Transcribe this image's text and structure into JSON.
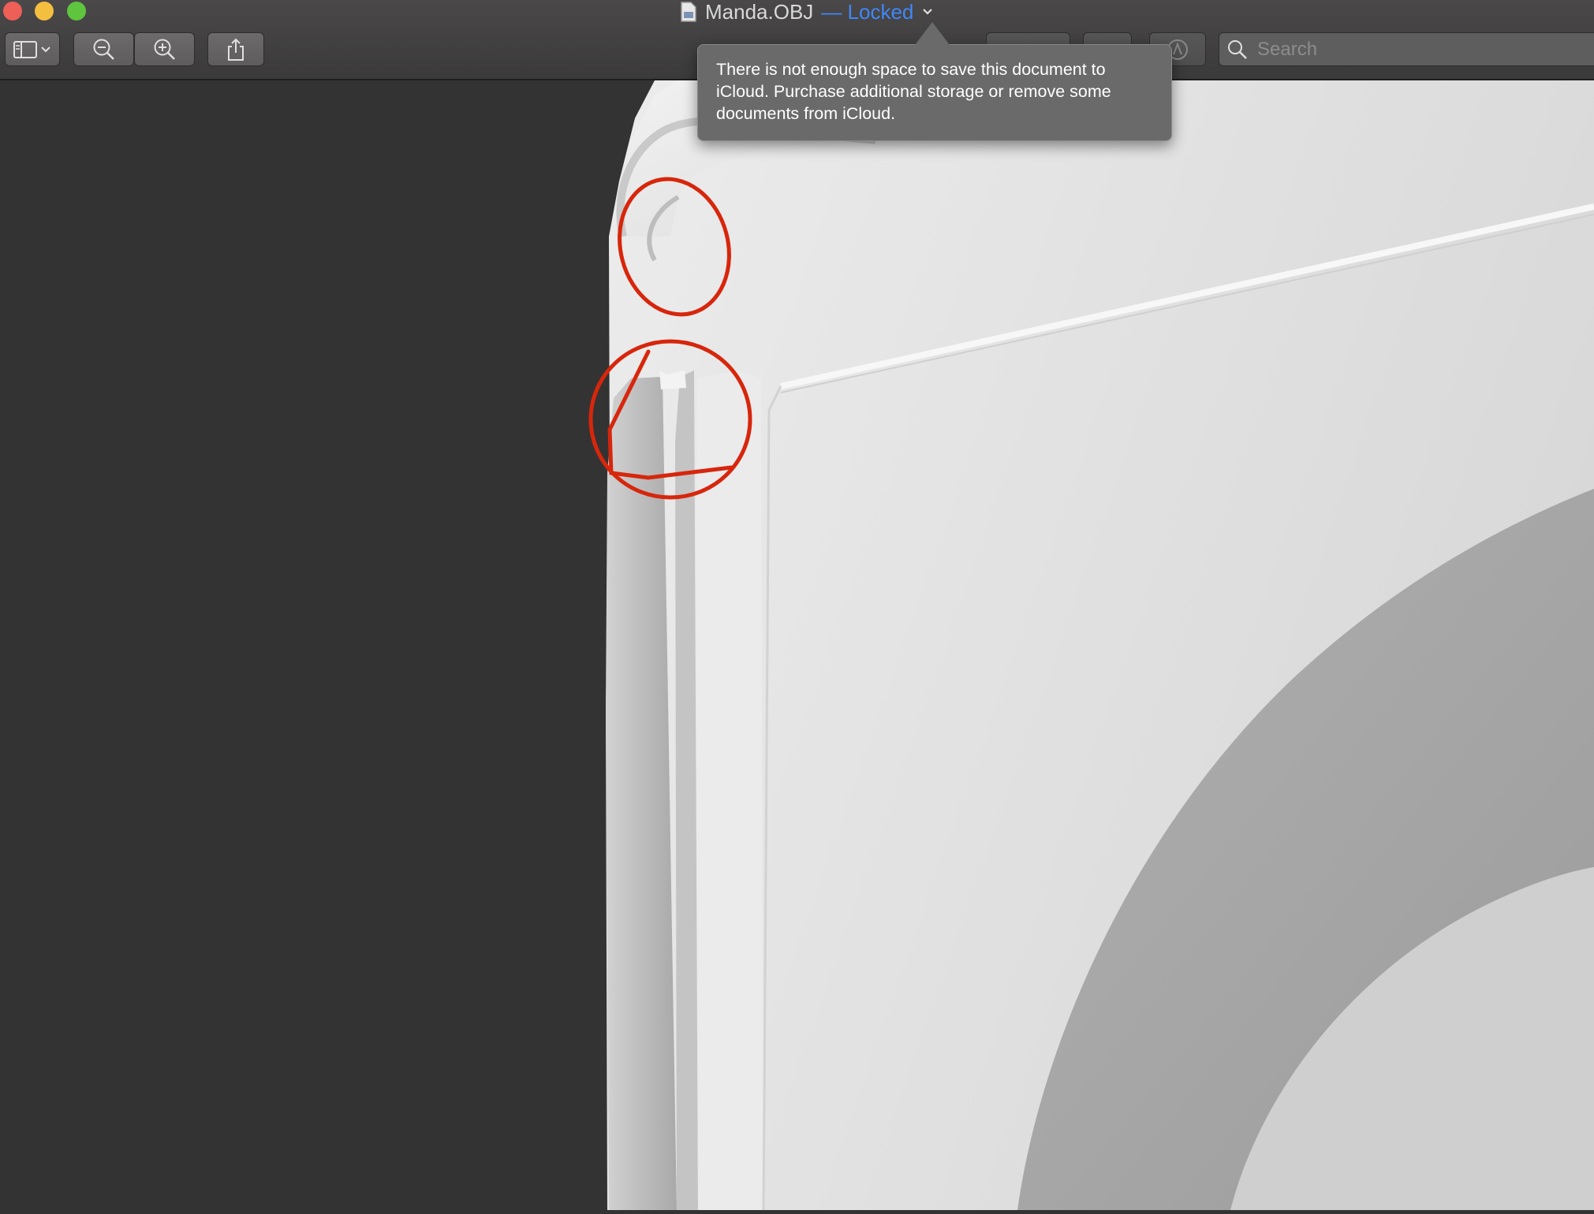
{
  "window": {
    "file_name": "Manda.OBJ",
    "status": "— Locked",
    "controls": [
      "close-button",
      "minimize-button",
      "zoom-button"
    ]
  },
  "toolbar": {
    "buttons": [
      "sidebar-toggle-icon",
      "zoom-out-icon",
      "zoom-in-icon",
      "share-icon",
      "rotate-icon",
      "markup-icon"
    ],
    "search_placeholder": "Search"
  },
  "tooltip": {
    "message": "There is not enough space to save this document to iCloud. Purchase additional storage or remove some documents from iCloud."
  },
  "colors": {
    "window_background": "#333333",
    "locked_accent": "#3f87f7",
    "annotation_stroke": "#d7260c",
    "model_surface": "#e6e6e6"
  }
}
